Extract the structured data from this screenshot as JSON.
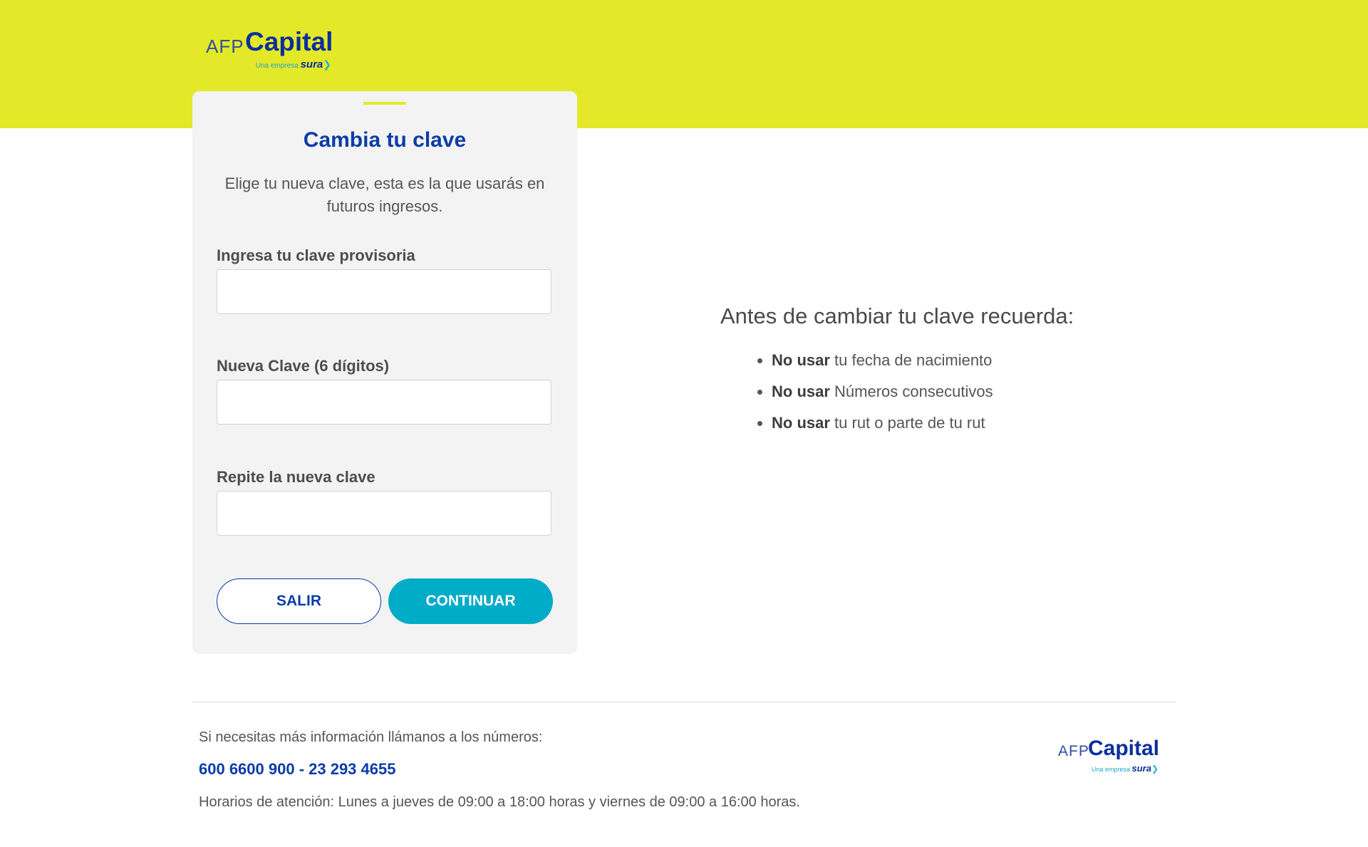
{
  "brand": {
    "afp": "AFP",
    "capital": "Capital",
    "tagline": "Una empresa",
    "group": "sura",
    "colors": {
      "header_band": "#e3e928",
      "primary_blue": "#0a3ca8",
      "accent_cyan": "#00acc8",
      "card_bg": "#f3f3f3"
    }
  },
  "form": {
    "title": "Cambia tu clave",
    "description": "Elige tu nueva clave, esta es la que usarás en futuros ingresos.",
    "fields": [
      {
        "label": "Ingresa tu clave provisoria",
        "value": ""
      },
      {
        "label": "Nueva Clave (6 dígitos)",
        "value": ""
      },
      {
        "label": "Repite la nueva clave",
        "value": ""
      }
    ],
    "buttons": {
      "cancel": "SALIR",
      "submit": "CONTINUAR"
    }
  },
  "tips": {
    "title": "Antes de cambiar tu clave recuerda:",
    "items": [
      {
        "emphasis": "No usar",
        "text": " tu fecha de nacimiento"
      },
      {
        "emphasis": "No usar",
        "text": " Números consecutivos"
      },
      {
        "emphasis": "No usar",
        "text": " tu rut o parte de tu rut"
      }
    ]
  },
  "footer": {
    "info": "Si necesitas más información llámanos a los números:",
    "phones": "600 6600 900 - 23 293 4655",
    "hours": "Horarios de atención: Lunes a jueves de 09:00 a 18:00 horas y viernes de 09:00 a 16:00 horas."
  }
}
